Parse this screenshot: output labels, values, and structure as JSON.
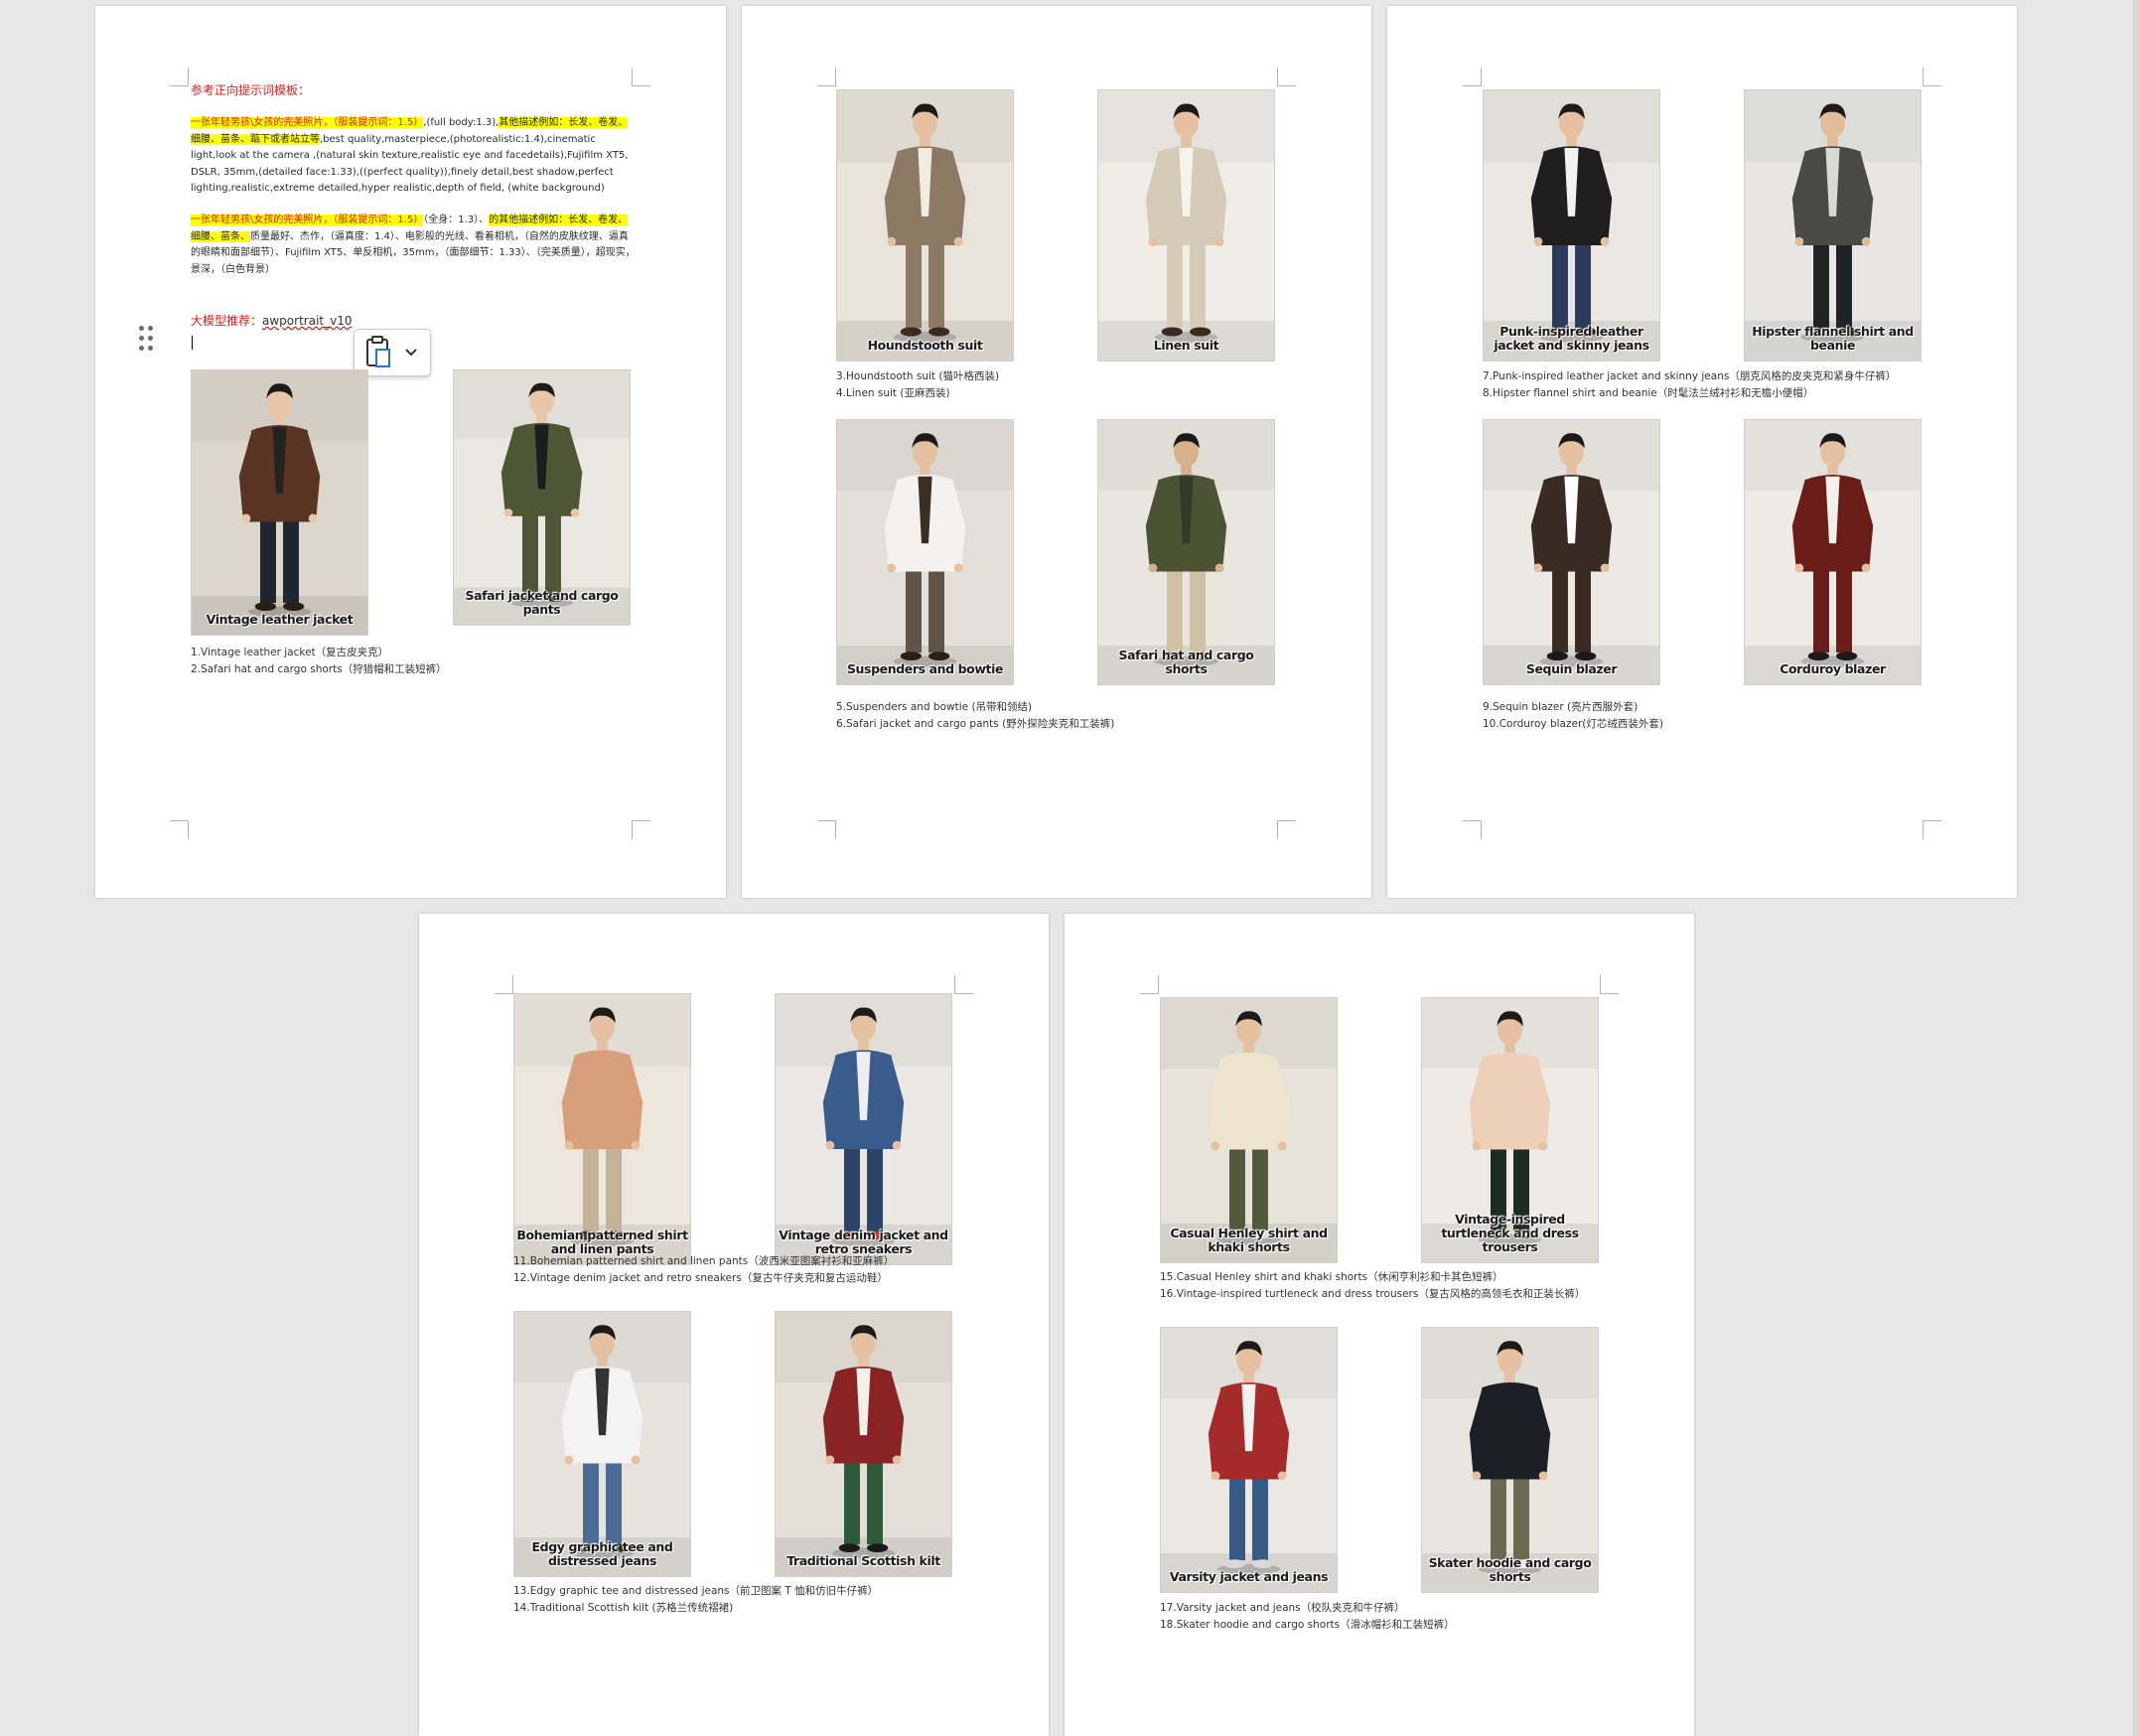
{
  "page1": {
    "heading": "参考正向提示词模板：",
    "p1_hl1": "一张年轻男孩\\女孩的完美照片，（服装提示词：1.5）",
    "p1_mid": ",(full body:1.3),",
    "p1_hl2": "其他描述例如：长发、卷发、细腰、苗条、踮下或者站立等",
    "p1_rest": ",best quality,masterpiece,(photorealistic:1.4),cinematic light,look at the camera ,(natural skin texture,realistic eye and facedetails),Fujifilm XT5, DSLR, 35mm,(detailed face:1.33),((perfect quality)),finely detail,best shadow,perfect lighting,realistic,extreme detailed,hyper realistic,depth of field, (white background)",
    "p2_hl1": "一张年轻男孩\\女孩的完美照片，（服装提示词：1.5）",
    "p2_mid": "（全身：1.3）、",
    "p2_hl2": "的其他描述例如：长发、卷发、细腰、苗条、",
    "p2_rest": "质量最好、杰作，（逼真度：1.4）、电影般的光线、看着相机，（自然的皮肤纹理、逼真的眼睛和面部细节）、Fujifilm XT5、单反相机，35mm，（面部细节：1.33）、（完美质量），超现实，景深，（白色背景）",
    "model_label": "大模型推荐：",
    "model_name": "awportrait_v10",
    "list": [
      "1.Vintage leather jacket（复古皮夹克）",
      "2.Safari hat and cargo shorts（狩猎帽和工装短裤）"
    ]
  },
  "page2": {
    "list1": [
      "3.Houndstooth suit (猫叶格西装)",
      "4.Linen suit (亚麻西装)"
    ],
    "list2": [
      "5.Suspenders and bowtie (吊带和领结)",
      "6.Safari jacket and cargo pants (野外探险夹克和工装裤)"
    ]
  },
  "page3": {
    "list1": [
      "7.Punk-inspired leather jacket and skinny jeans（朋克风格的皮夹克和紧身牛仔裤）",
      "8.Hipster flannel shirt and beanie（时髦法兰绒衬衫和无檐小便帽）"
    ],
    "list2": [
      "9.Sequin blazer (亮片西服外套)",
      "10.Corduroy blazer(灯芯绒西装外套)"
    ]
  },
  "page4": {
    "list1": [
      "11.Bohemian patterned shirt and linen pants（波西米亚图案衬衫和亚麻裤）",
      "12.Vintage denim jacket and retro sneakers（复古牛仔夹克和复古运动鞋）"
    ],
    "list2": [
      "13.Edgy graphic tee and distressed jeans（前卫图案 T 恤和仿旧牛仔裤）",
      "14.Traditional Scottish kilt (苏格兰传统褶裙)"
    ]
  },
  "page5": {
    "list1": [
      "15.Casual Henley shirt and khaki shorts（休闲亨利衫和卡其色短裤）",
      "16.Vintage-inspired turtleneck and dress trousers（复古风格的高领毛衣和正装长裤）"
    ],
    "list2": [
      "17.Varsity jacket and jeans（校队夹克和牛仔裤）",
      "18.Skater hoodie and cargo shorts（滑冰帽衫和工装短裤）"
    ]
  },
  "photos": [
    {
      "caption": "Vintage leather jacket",
      "bg": "#dcd6cc",
      "top": "#5a3422",
      "inner": "#222222",
      "pants": "#1e2430",
      "shoes": "#2a1d16",
      "skin": "#e8c6a8"
    },
    {
      "caption": "Safari jacket and cargo pants",
      "bg": "#ebe8e1",
      "top": "#4e5636",
      "inner": "#1d1d1d",
      "pants": "#4e5636",
      "shoes": "#3a2c20",
      "skin": "#e8c6a8"
    },
    {
      "caption": "Houndstooth suit",
      "bg": "#e8e3db",
      "top": "#8c7a64",
      "inner": "#f1ece3",
      "pants": "#8c7a64",
      "shoes": "#3b2a1f",
      "skin": "#e5c1a1"
    },
    {
      "caption": "Linen suit",
      "bg": "#f0ece6",
      "top": "#d6cbb6",
      "inner": "#f6f3ee",
      "pants": "#d6cbb6",
      "shoes": "#3b2a1f",
      "skin": "#e5c1a1"
    },
    {
      "caption": "Suspenders and bowtie",
      "bg": "#e4e0d9",
      "top": "#f4f2ee",
      "inner": "#3a2f27",
      "pants": "#5f5446",
      "shoes": "#2a2018",
      "skin": "#e5c1a1"
    },
    {
      "caption": "Safari hat and cargo shorts",
      "bg": "#e9e6df",
      "top": "#4b5334",
      "inner": "#343a26",
      "pants": "#cfc2a4",
      "shoes": "#5a4030",
      "skin": "#d8b08c"
    },
    {
      "caption": "Punk-inspired leather jacket and skinny jeans",
      "bg": "#ebe8e3",
      "top": "#1e1e1e",
      "inner": "#f2f2f2",
      "pants": "#2a3a5c",
      "shoes": "#1a1a1a",
      "skin": "#e5c1a1"
    },
    {
      "caption": "Hipster flannel shirt and beanie",
      "bg": "#e7e6e2",
      "top": "#4a4a44",
      "inner": "#d9d9d4",
      "pants": "#1f2226",
      "shoes": "#1a1a1a",
      "skin": "#e2bc98"
    },
    {
      "caption": "Sequin blazer",
      "bg": "#ece9e4",
      "top": "#3a2b22",
      "inner": "#ffffff",
      "pants": "#3a2b22",
      "shoes": "#1a1a1a",
      "skin": "#e5c1a1"
    },
    {
      "caption": "Corduroy blazer",
      "bg": "#eeebe6",
      "top": "#6a1c18",
      "inner": "#f3f0eb",
      "pants": "#6a1c18",
      "shoes": "#1a1a1a",
      "skin": "#e5c1a1"
    },
    {
      "caption": "Bohemian patterned shirt and linen pants",
      "bg": "#ece6dd",
      "top": "#d79f7c",
      "inner": "#d79f7c",
      "pants": "#c4b39a",
      "shoes": "#3b2a1f",
      "skin": "#e5c1a1"
    },
    {
      "caption": "Vintage denim jacket and retro sneakers",
      "bg": "#ebe8e3",
      "top": "#3a5c8c",
      "inner": "#eeeeee",
      "pants": "#2c4468",
      "shoes": "#b23a2a",
      "skin": "#e5c1a1"
    },
    {
      "caption": "Edgy graphic tee and distressed jeans",
      "bg": "#e6e3dd",
      "top": "#f3f3f3",
      "inner": "#333333",
      "pants": "#4a6b96",
      "shoes": "#222222",
      "skin": "#e5c1a1"
    },
    {
      "caption": "Traditional Scottish kilt",
      "bg": "#e4e0d8",
      "top": "#8a2424",
      "inner": "#f3f0eb",
      "pants": "#2e5a3a",
      "shoes": "#1a1a1a",
      "skin": "#e5c1a1"
    },
    {
      "caption": "Casual Henley shirt and khaki shorts",
      "bg": "#e7e2da",
      "top": "#efe5cf",
      "inner": "#efe5cf",
      "pants": "#4f5a3c",
      "shoes": "#dcdcdc",
      "skin": "#e5c1a1"
    },
    {
      "caption": "Vintage-inspired turtleneck and dress trousers",
      "bg": "#eeebe6",
      "top": "#eecfb8",
      "inner": "#eecfb8",
      "pants": "#1e2a24",
      "shoes": "#1a1a1a",
      "skin": "#e5c1a1"
    },
    {
      "caption": "Varsity jacket and jeans",
      "bg": "#ebe8e3",
      "top": "#a52a2a",
      "inner": "#f1f1f1",
      "pants": "#365a86",
      "shoes": "#d8d8d8",
      "skin": "#e5c1a1"
    },
    {
      "caption": "Skater hoodie and cargo shorts",
      "bg": "#e9e6e0",
      "top": "#1c1f26",
      "inner": "#1c1f26",
      "pants": "#6a6a52",
      "shoes": "#eeeeee",
      "skin": "#e5c1a1"
    }
  ]
}
